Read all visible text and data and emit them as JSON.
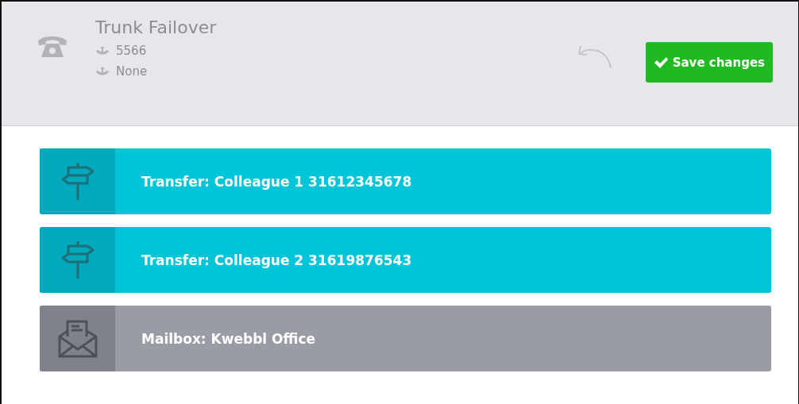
{
  "header": {
    "title": "Trunk Failover",
    "numbers": [
      "5566",
      "None"
    ],
    "save_button": "Save changes"
  },
  "actions": [
    {
      "kind": "transfer",
      "label": "Transfer: Colleague 1 31612345678"
    },
    {
      "kind": "transfer",
      "label": "Transfer: Colleague 2 31619876543"
    },
    {
      "kind": "mailbox",
      "label": "Mailbox: Kwebbl Office"
    }
  ]
}
